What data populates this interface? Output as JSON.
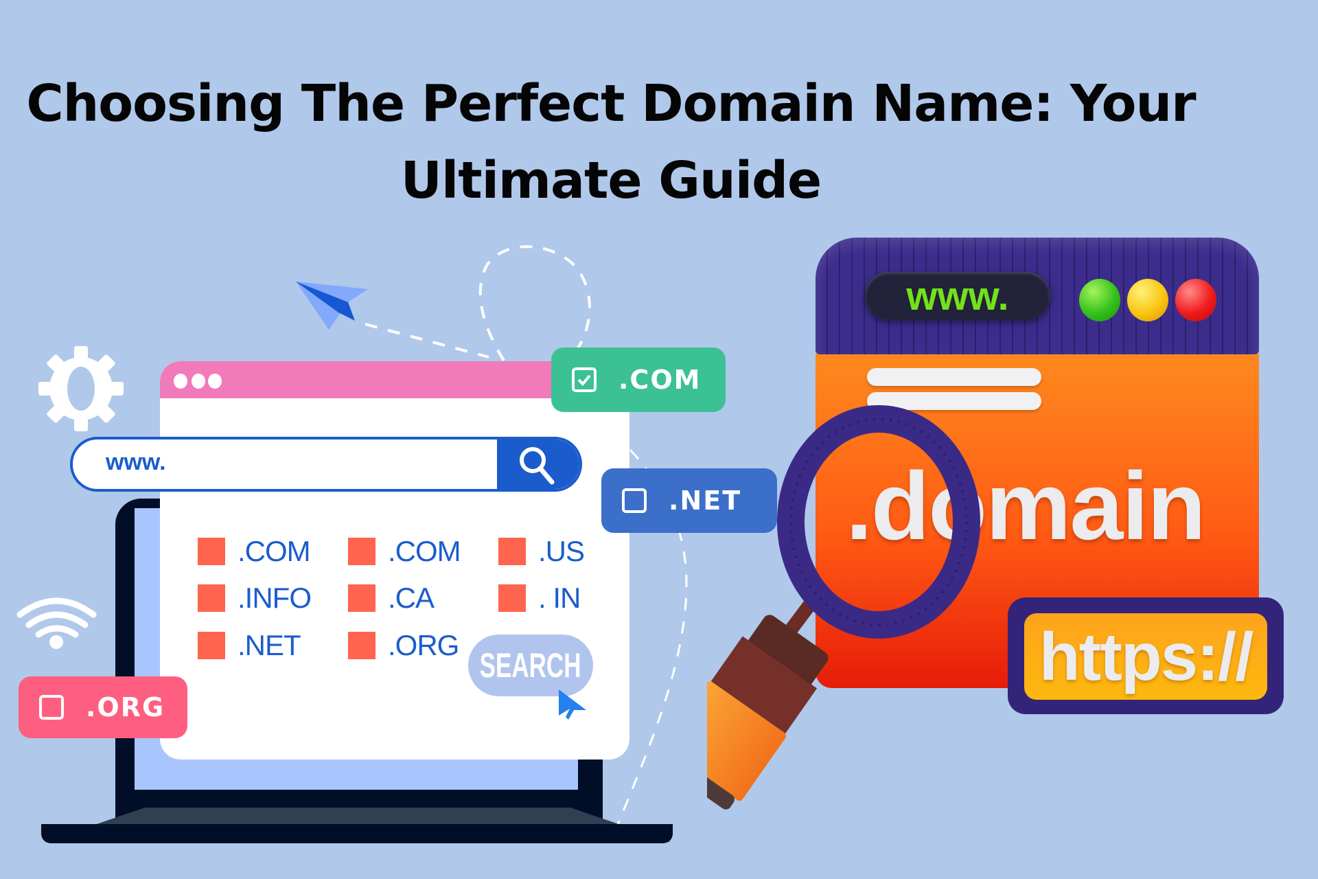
{
  "title": {
    "line1": "Choosing The Perfect Domain Name: Your",
    "line2": "Ultimate Guide"
  },
  "left_illustration": {
    "search_bar": {
      "value": "www.",
      "button_icon": "search-icon"
    },
    "tld_list": [
      [
        ".COM",
        ".COM",
        ".US"
      ],
      [
        ".INFO",
        ".CA",
        ". IN"
      ],
      [
        ".NET",
        ".ORG"
      ]
    ],
    "search_button_label": "SEARCH",
    "tags": [
      {
        "label": ".COM",
        "checked": true,
        "color": "#3cc195"
      },
      {
        "label": ".NET",
        "checked": false,
        "color": "#3c6fca"
      },
      {
        "label": ".ORG",
        "checked": false,
        "color": "#fe5f80"
      }
    ],
    "icons": [
      "gear-icon",
      "wifi-icon",
      "paper-plane-icon",
      "cursor-icon"
    ]
  },
  "right_illustration": {
    "address_pill": "www.",
    "traffic_lights": [
      "#33c11a",
      "#f9c510",
      "#f01a1a"
    ],
    "domain_text": ".domain",
    "protocol_text": "https://",
    "icons": [
      "magnifying-glass-icon"
    ]
  },
  "colors": {
    "background": "#b0c8ea",
    "browser_bar": "#f17aba",
    "accent_blue": "#1b5ccc",
    "tld_square": "#fe644e",
    "window_top": "#3c2d8c",
    "window_body": "#ff5a14"
  }
}
